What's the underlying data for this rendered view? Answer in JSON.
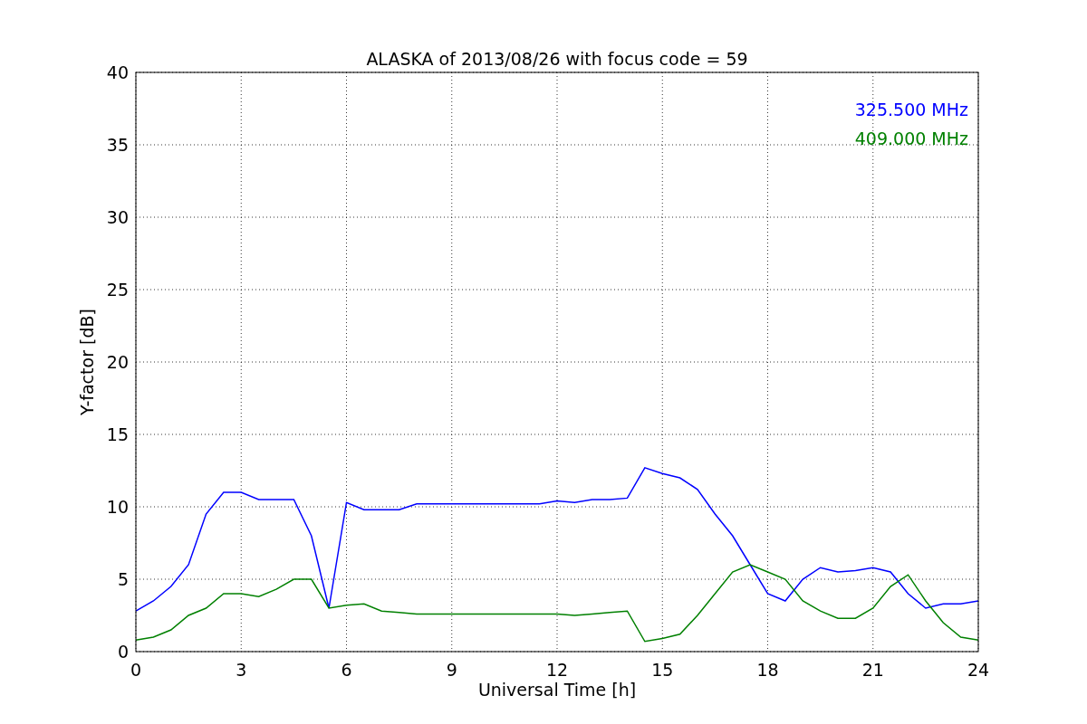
{
  "chart_data": {
    "type": "line",
    "title": "ALASKA of 2013/08/26 with focus code = 59",
    "xlabel": "Universal Time [h]",
    "ylabel": "Y-factor [dB]",
    "x": [
      0,
      0.5,
      1,
      1.5,
      2,
      2.5,
      3,
      3.5,
      4,
      4.5,
      5,
      5.5,
      6,
      6.5,
      7,
      7.5,
      8,
      8.5,
      9,
      9.5,
      10,
      10.5,
      11,
      11.5,
      12,
      12.5,
      13,
      13.5,
      14,
      14.5,
      15,
      15.5,
      16,
      16.5,
      17,
      17.5,
      18,
      18.5,
      19,
      19.5,
      20,
      20.5,
      21,
      21.5,
      22,
      22.5,
      23,
      23.5,
      24
    ],
    "series": [
      {
        "name": "325.500 MHz",
        "color": "#0000ff",
        "values": [
          2.8,
          3.5,
          4.5,
          6,
          9.5,
          11,
          11,
          10.5,
          10.5,
          10.5,
          8,
          3,
          10.3,
          9.8,
          9.8,
          9.8,
          10.2,
          10.2,
          10.2,
          10.2,
          10.2,
          10.2,
          10.2,
          10.2,
          10.4,
          10.3,
          10.5,
          10.5,
          10.6,
          12.7,
          12.3,
          12,
          11.2,
          9.5,
          8,
          6,
          4,
          3.5,
          5,
          5.8,
          5.5,
          5.6,
          5.8,
          5.5,
          4,
          3,
          3.3,
          3.3,
          3.5
        ]
      },
      {
        "name": "409.000 MHz",
        "color": "#008000",
        "values": [
          0.8,
          1,
          1.5,
          2.5,
          3,
          4,
          4,
          3.8,
          4.3,
          5,
          5,
          3,
          3.2,
          3.3,
          2.8,
          2.7,
          2.6,
          2.6,
          2.6,
          2.6,
          2.6,
          2.6,
          2.6,
          2.6,
          2.6,
          2.5,
          2.6,
          2.7,
          2.8,
          0.7,
          0.9,
          1.2,
          2.5,
          4,
          5.5,
          6,
          5.5,
          5,
          3.5,
          2.8,
          2.3,
          2.3,
          3,
          4.5,
          5.3,
          3.5,
          2,
          1,
          0.8
        ]
      }
    ],
    "xlim": [
      0,
      24
    ],
    "ylim": [
      0,
      40
    ],
    "xticks": [
      0,
      3,
      6,
      9,
      12,
      15,
      18,
      21,
      24
    ],
    "yticks": [
      0,
      5,
      10,
      15,
      20,
      25,
      30,
      35,
      40
    ],
    "grid": true
  }
}
